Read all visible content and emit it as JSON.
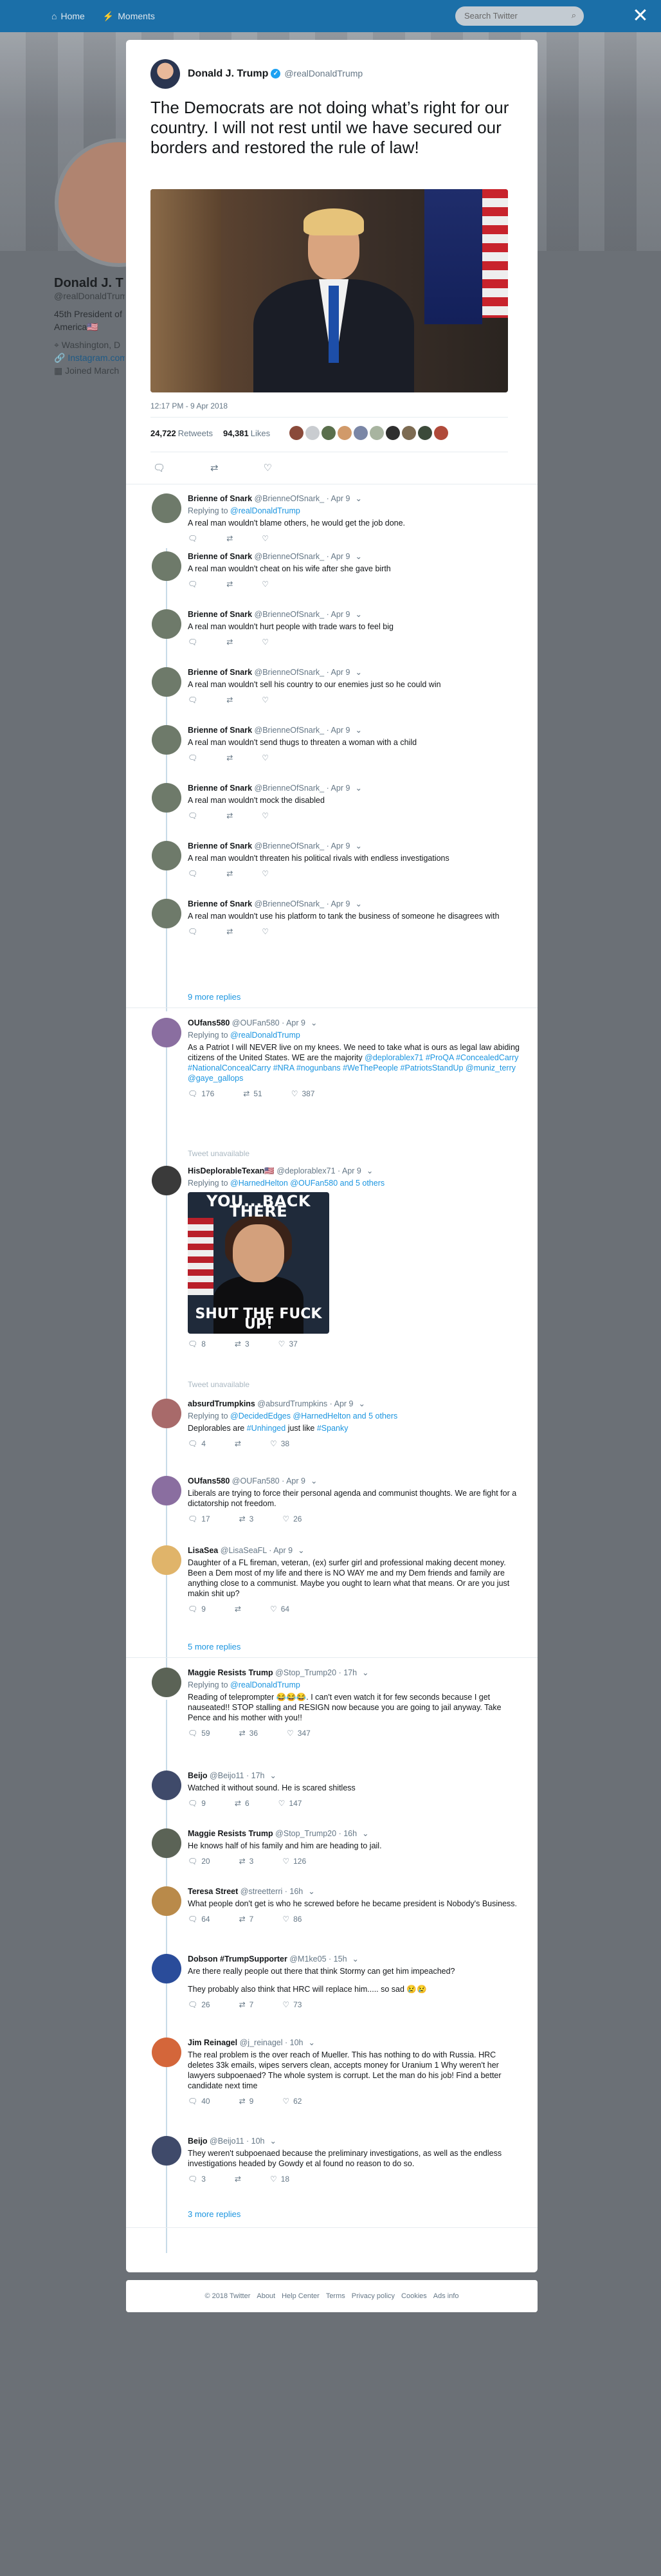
{
  "colors": {
    "accent": "#1b95e0",
    "verified": "#1da1f2",
    "backdrop": "#666a6f"
  },
  "nav": {
    "home": "Home",
    "moments": "Moments",
    "search_placeholder": "Search Twitter"
  },
  "close_label": "✕",
  "profile": {
    "name": "Donald J. T",
    "handle": "@realDonaldTrum",
    "bio_line1": "45th President of",
    "bio_line2": "America🇺🇸",
    "location": "Washington, D",
    "link": "Instagram.com",
    "joined": "Joined March"
  },
  "main_tweet": {
    "name": "Donald J. Trump",
    "handle": "@realDonaldTrump",
    "text": "The Democrats are not doing what’s right for our country. I will not rest until we have secured our borders and restored the rule of law!",
    "time": "12:17 PM - 9 Apr 2018",
    "retweets_count": "24,722",
    "retweets_label": "Retweets",
    "likes_count": "94,381",
    "likes_label": "Likes"
  },
  "replies_block1": [
    {
      "name": "Brienne of Snark",
      "handle": "@BrienneOfSnark_",
      "date": "Apr 9",
      "replying": "@realDonaldTrump",
      "text": "A real man wouldn't blame others, he would get the job done."
    },
    {
      "name": "Brienne of Snark",
      "handle": "@BrienneOfSnark_",
      "date": "Apr 9",
      "text": "A real man wouldn't cheat on his wife after she gave birth"
    },
    {
      "name": "Brienne of Snark",
      "handle": "@BrienneOfSnark_",
      "date": "Apr 9",
      "text": "A real man wouldn't hurt people with trade wars to feel big"
    },
    {
      "name": "Brienne of Snark",
      "handle": "@BrienneOfSnark_",
      "date": "Apr 9",
      "text": "A real man wouldn't sell his country to our enemies just so he could win"
    },
    {
      "name": "Brienne of Snark",
      "handle": "@BrienneOfSnark_",
      "date": "Apr 9",
      "text": "A real man wouldn't send thugs to threaten a woman with a child"
    },
    {
      "name": "Brienne of Snark",
      "handle": "@BrienneOfSnark_",
      "date": "Apr 9",
      "text": "A real man wouldn't mock the disabled"
    },
    {
      "name": "Brienne of Snark",
      "handle": "@BrienneOfSnark_",
      "date": "Apr 9",
      "text": "A real man wouldn't threaten his political rivals with endless investigations"
    },
    {
      "name": "Brienne of Snark",
      "handle": "@BrienneOfSnark_",
      "date": "Apr 9",
      "text": "A real man wouldn't use his platform to tank the business of someone he disagrees with"
    }
  ],
  "more_replies_1": "9 more replies",
  "ou": {
    "name": "OUfans580",
    "handle": "@OUFan580",
    "date": "Apr 9",
    "replying": "@realDonaldTrump",
    "text": "As a Patriot I will NEVER live on my knees. We need to take what is ours as legal law abiding citizens of the United States. WE are the majority",
    "tags": "@deplorablex71 #ProQA #ConcealedCarry #NationalConcealCarry #NRA #nogunbans #WeThePeople #PatriotsStandUp",
    "mentions": "@muniz_terry @gaye_gallops",
    "replies": "176",
    "retweets": "51",
    "likes": "387"
  },
  "tweet_unavailable_1": "Tweet unavailable",
  "his": {
    "name": "HisDeplorableTexan🇺🇸",
    "handle": "@deplorablex71",
    "date": "Apr 9",
    "replying": "@HarnedHelton @OUFan580 and 5 others",
    "meme_top": "YOU...BACK THERE",
    "meme_bottom": "SHUT THE FUCK UP!",
    "replies": "8",
    "retweets": "3",
    "likes": "37"
  },
  "tweet_unavailable_2": "Tweet unavailable",
  "absurd": {
    "name": "absurdTrumpkins",
    "handle": "@absurdTrumpkins",
    "date": "Apr 9",
    "replying": "@DecidedEdges @HarnedHelton and 5 others",
    "text_a": "Deplorables are ",
    "tag1": "#Unhinged",
    "text_b": " just like ",
    "tag2": "#Spanky",
    "replies": "4",
    "retweets": "",
    "likes": "38"
  },
  "ou2": {
    "name": "OUfans580",
    "handle": "@OUFan580",
    "date": "Apr 9",
    "text": "Liberals are trying to force their personal agenda and communist thoughts. We are fight for a dictatorship not freedom.",
    "replies": "17",
    "retweets": "3",
    "likes": "26"
  },
  "lisa": {
    "name": "LisaSea",
    "handle": "@LisaSeaFL",
    "date": "Apr 9",
    "text": "Daughter of a FL fireman, veteran, (ex) surfer girl and professional making decent money. Been a Dem most of my life and there is NO WAY me and my Dem friends and family are anything close to a communist. Maybe you ought to learn what that means. Or are you just makin shit up?",
    "replies": "9",
    "retweets": "",
    "likes": "64"
  },
  "more_replies_2": "5 more replies",
  "maggie": {
    "name": "Maggie Resists Trump",
    "handle": "@Stop_Trump20",
    "date": "17h",
    "replying": "@realDonaldTrump",
    "text": "Reading of teleprompter 😂😂😂. I can't even watch it for few seconds because I get nauseated!! STOP stalling and RESIGN now because you are going to jail anyway. Take Pence and his mother with you!!",
    "replies": "59",
    "retweets": "36",
    "likes": "347"
  },
  "beijo1": {
    "name": "Beijo",
    "handle": "@Beijo11",
    "date": "17h",
    "text": "Watched it without sound.  He is scared shitless",
    "replies": "9",
    "retweets": "6",
    "likes": "147"
  },
  "maggie2": {
    "name": "Maggie Resists Trump",
    "handle": "@Stop_Trump20",
    "date": "16h",
    "text": "He knows half of his family and him are heading to jail.",
    "replies": "20",
    "retweets": "3",
    "likes": "126"
  },
  "teresa": {
    "name": "Teresa Street",
    "handle": "@streetterri",
    "date": "16h",
    "text": "What people don't get is who he screwed before he became president is Nobody's Business.",
    "replies": "64",
    "retweets": "7",
    "likes": "86"
  },
  "dobson": {
    "name": "Dobson #TrumpSupporter",
    "handle": "@M1ke05",
    "date": "15h",
    "text1": "Are there really people out there that think Stormy can get him impeached?",
    "text2": "They probably also think that HRC will replace him..... so sad 😢😢",
    "replies": "26",
    "retweets": "7",
    "likes": "73"
  },
  "jim": {
    "name": "Jim Reinagel",
    "handle": "@j_reinagel",
    "date": "10h",
    "text": "The real problem is the over reach of Mueller. This has nothing to do with Russia. HRC deletes 33k emails, wipes servers clean, accepts money for Uranium 1 Why weren't her lawyers subpoenaed? The whole system is corrupt. Let the man do his job! Find a better candidate next time",
    "replies": "40",
    "retweets": "9",
    "likes": "62"
  },
  "beijo2": {
    "name": "Beijo",
    "handle": "@Beijo11",
    "date": "10h",
    "text": "They weren't subpoenaed because the preliminary investigations, as well as the endless investigations headed by Gowdy et al found no reason to do so.",
    "replies": "3",
    "retweets": "",
    "likes": "18"
  },
  "more_replies_3": "3 more replies",
  "footer": [
    "© 2018 Twitter",
    "About",
    "Help Center",
    "Terms",
    "Privacy policy",
    "Cookies",
    "Ads info"
  ]
}
